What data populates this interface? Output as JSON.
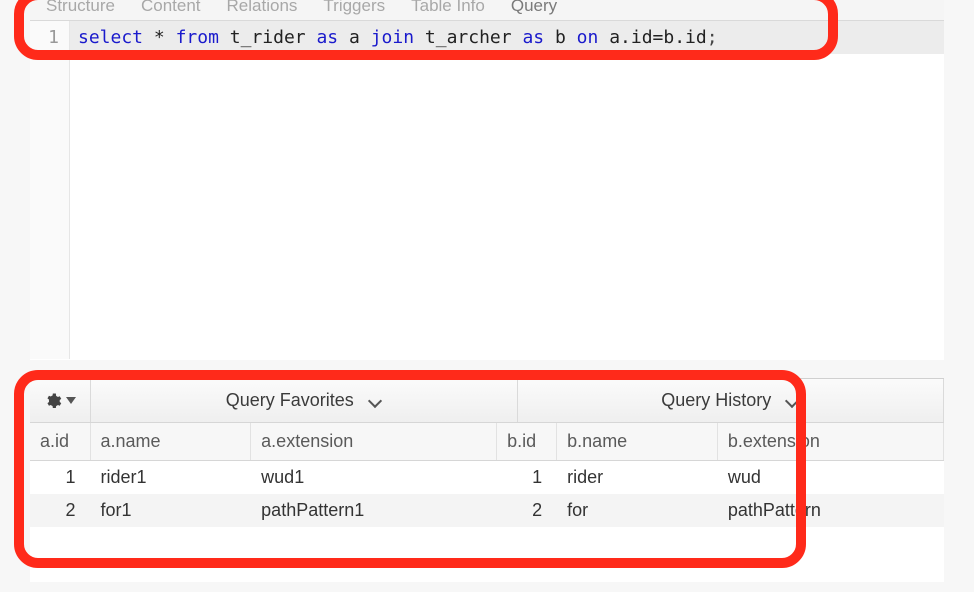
{
  "tabs": [
    "Structure",
    "Content",
    "Relations",
    "Triggers",
    "Table Info",
    "Query"
  ],
  "active_tab_index": 5,
  "editor": {
    "line_number": "1",
    "tokens": {
      "select": "select",
      "star": "*",
      "from": "from",
      "t_rider": "t_rider",
      "as1": "as",
      "a": "a",
      "join": "join",
      "t_archer": "t_archer",
      "as2": "as",
      "b": "b",
      "on": "on",
      "cond": "a.id=b.id",
      "semi": ";"
    }
  },
  "toolbar": {
    "favorites_label": "Query Favorites",
    "history_label": "Query History"
  },
  "results": {
    "columns": [
      "a.id",
      "a.name",
      "a.extension",
      "b.id",
      "b.name",
      "b.extension"
    ],
    "rows": [
      {
        "a_id": "1",
        "a_name": "rider1",
        "a_ext": "wud1",
        "b_id": "1",
        "b_name": "rider",
        "b_ext": "wud"
      },
      {
        "a_id": "2",
        "a_name": "for1",
        "a_ext": "pathPattern1",
        "b_id": "2",
        "b_name": "for",
        "b_ext": "pathPattern"
      }
    ]
  }
}
